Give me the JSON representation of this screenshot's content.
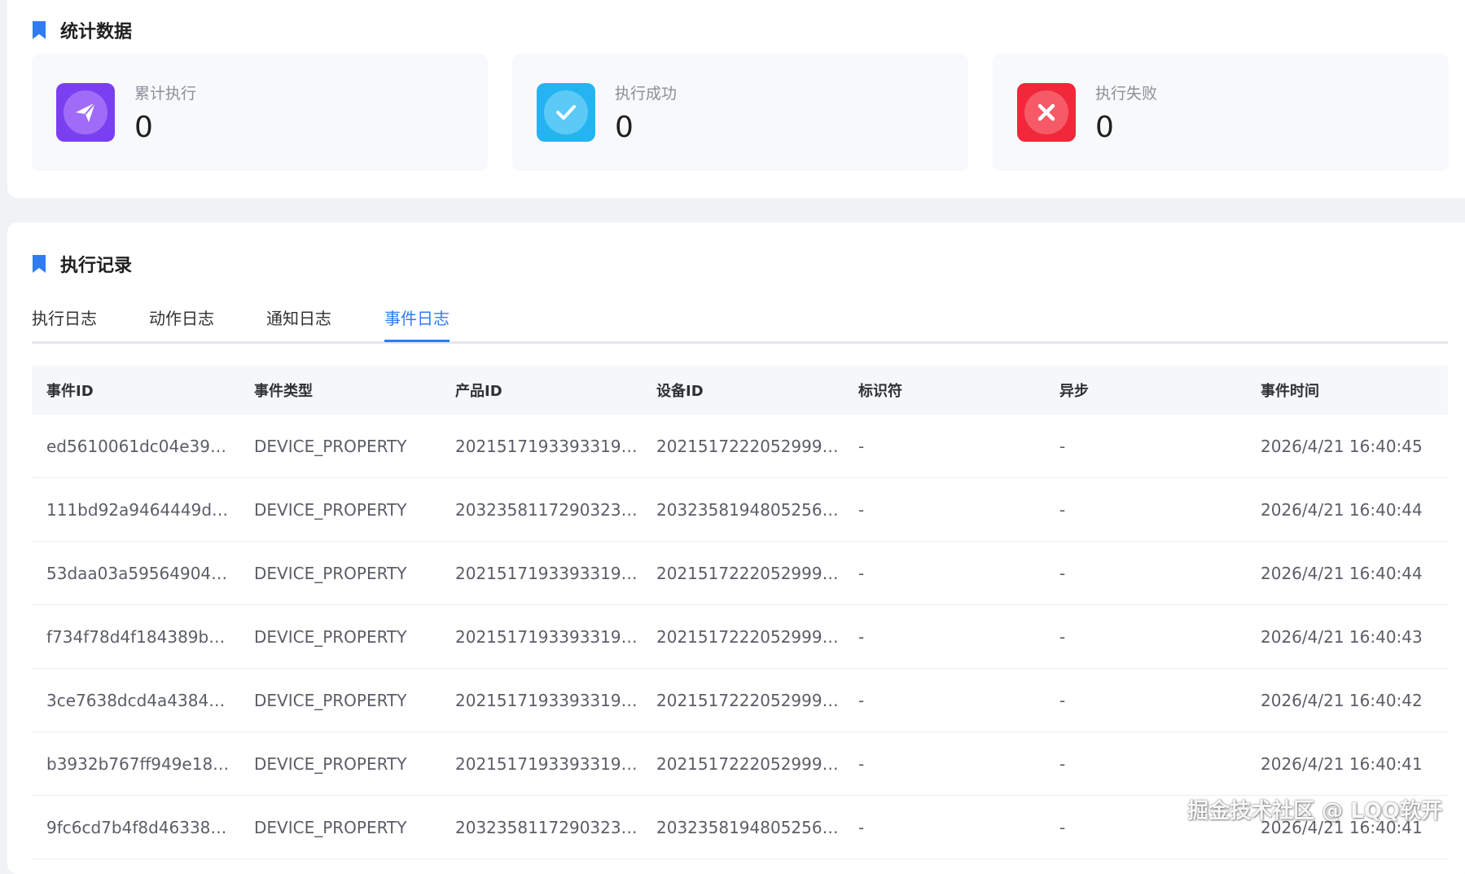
{
  "stats": {
    "title": "统计数据",
    "items": [
      {
        "label": "累计执行",
        "value": "0",
        "icon": "paper-plane-icon",
        "color": "#7b3ff2"
      },
      {
        "label": "执行成功",
        "value": "0",
        "icon": "check-icon",
        "color": "#25b4f2"
      },
      {
        "label": "执行失败",
        "value": "0",
        "icon": "close-icon",
        "color": "#f0283a"
      }
    ]
  },
  "records": {
    "title": "执行记录",
    "tabs": [
      {
        "label": "执行日志"
      },
      {
        "label": "动作日志"
      },
      {
        "label": "通知日志"
      },
      {
        "label": "事件日志",
        "active": true
      }
    ],
    "table": {
      "headers": [
        "事件ID",
        "事件类型",
        "产品ID",
        "设备ID",
        "标识符",
        "异步",
        "事件时间"
      ],
      "rows": [
        [
          "ed5610061dc04e39…",
          "DEVICE_PROPERTY",
          "2021517193393319…",
          "2021517222052999…",
          "-",
          "-",
          "2026/4/21 16:40:45"
        ],
        [
          "111bd92a9464449d…",
          "DEVICE_PROPERTY",
          "2032358117290323…",
          "2032358194805256…",
          "-",
          "-",
          "2026/4/21 16:40:44"
        ],
        [
          "53daa03a59564904…",
          "DEVICE_PROPERTY",
          "2021517193393319…",
          "2021517222052999…",
          "-",
          "-",
          "2026/4/21 16:40:44"
        ],
        [
          "f734f78d4f184389b…",
          "DEVICE_PROPERTY",
          "2021517193393319…",
          "2021517222052999…",
          "-",
          "-",
          "2026/4/21 16:40:43"
        ],
        [
          "3ce7638dcd4a4384…",
          "DEVICE_PROPERTY",
          "2021517193393319…",
          "2021517222052999…",
          "-",
          "-",
          "2026/4/21 16:40:42"
        ],
        [
          "b3932b767ff949e18…",
          "DEVICE_PROPERTY",
          "2021517193393319…",
          "2021517222052999…",
          "-",
          "-",
          "2026/4/21 16:40:41"
        ],
        [
          "9fc6cd7b4f8d46338…",
          "DEVICE_PROPERTY",
          "2032358117290323…",
          "2032358194805256…",
          "-",
          "-",
          "2026/4/21 16:40:41"
        ]
      ]
    }
  },
  "watermark": "掘金技术社区 @ LQQ软开",
  "accent_color": "#2f7cf6"
}
